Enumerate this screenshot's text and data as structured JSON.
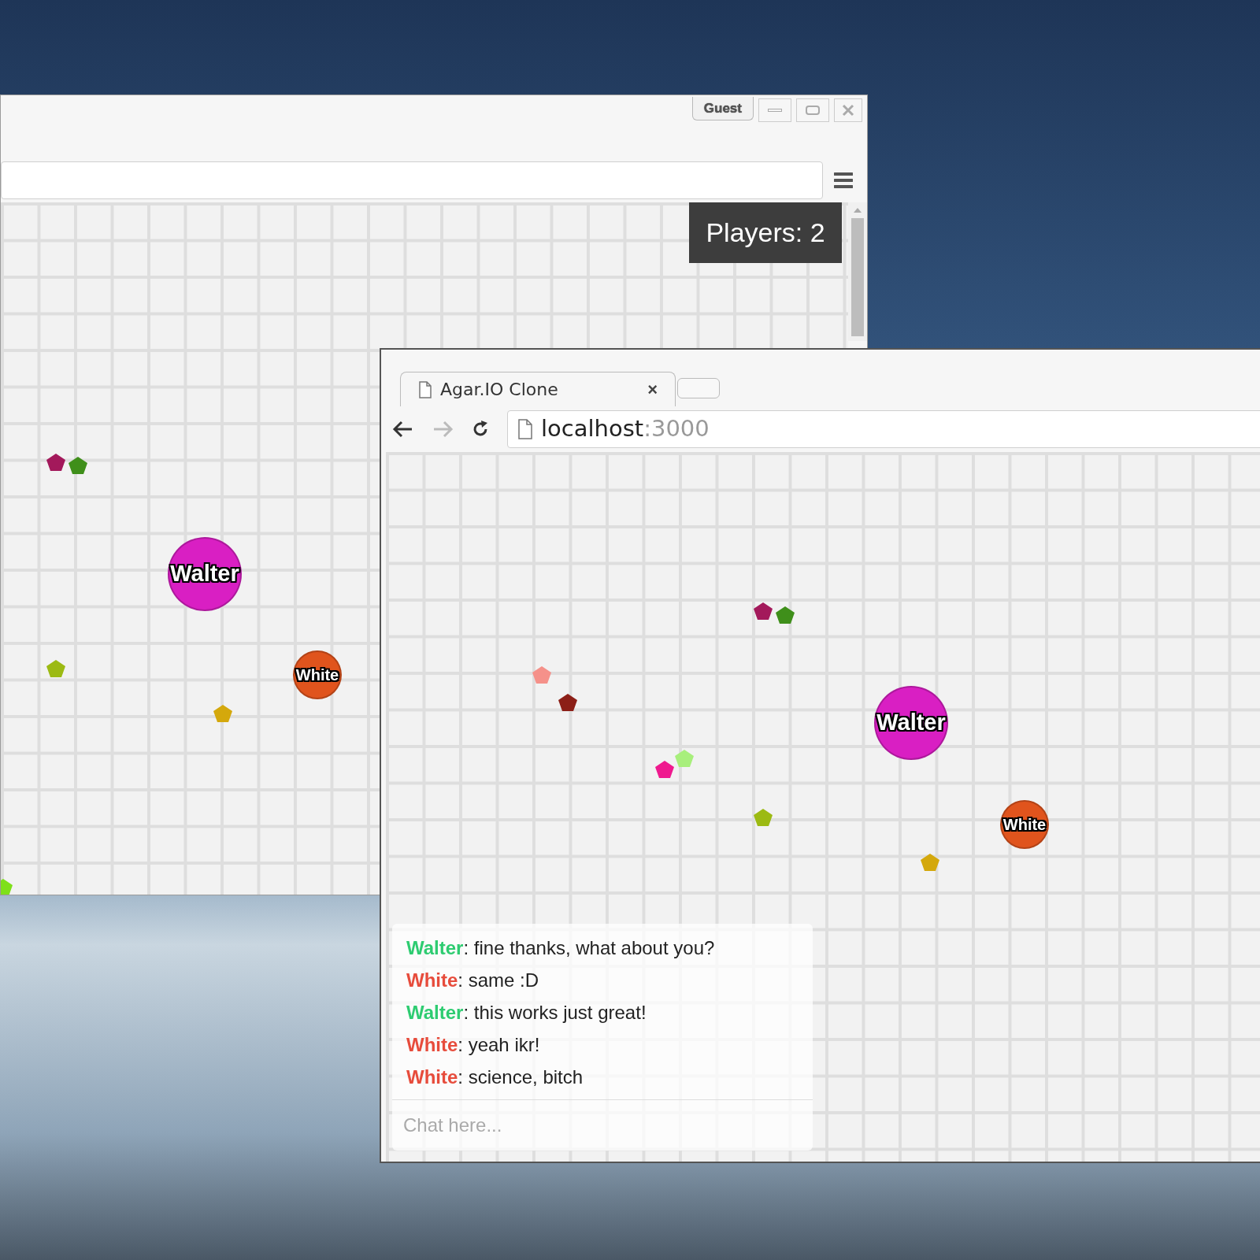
{
  "back_window": {
    "profile_button": "Guest",
    "players_label": "Players: 2",
    "cells": [
      {
        "name": "Walter",
        "color": "#d91fc3"
      },
      {
        "name": "White",
        "color": "#e0541d"
      }
    ]
  },
  "front_window": {
    "tab": {
      "title": "Agar.IO Clone",
      "close": "×"
    },
    "address": {
      "host": "localhost",
      "port": ":3000"
    },
    "nav": {
      "forward_disabled": true
    },
    "cells": [
      {
        "name": "Walter",
        "color": "#d91fc3"
      },
      {
        "name": "White",
        "color": "#e0541d"
      }
    ],
    "chat": {
      "messages": [
        {
          "sender": "Walter",
          "color": "#2ecc71",
          "text": ": fine thanks, what about you?"
        },
        {
          "sender": "White",
          "color": "#e74c3c",
          "text": ": same :D"
        },
        {
          "sender": "Walter",
          "color": "#2ecc71",
          "text": ": this works just great!"
        },
        {
          "sender": "White",
          "color": "#e74c3c",
          "text": ": yeah ikr!"
        },
        {
          "sender": "White",
          "color": "#e74c3c",
          "text": ": science, bitch"
        }
      ],
      "placeholder": "Chat here..."
    }
  }
}
